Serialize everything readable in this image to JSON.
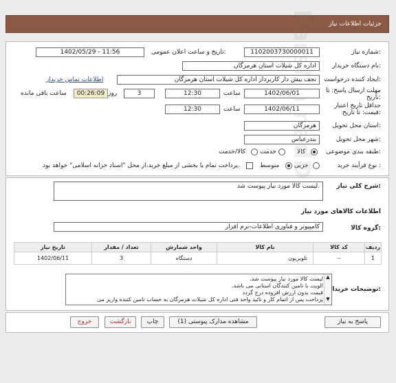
{
  "header": {
    "title": "جزئیات اطلاعات نیاز"
  },
  "form": {
    "need_number_label": "شماره نیاز:",
    "need_number": "1102003730000011",
    "announce_label": "تاریخ و ساعت اعلان عمومی:",
    "announce_value": "1402/05/29 - 11:56",
    "buyer_org_label": "نام دستگاه خریدار:",
    "buyer_org": "اداره کل شیلات استان هرمزگان",
    "creator_label": "ایجاد کننده درخواست:",
    "creator": "نجف بیش دار کاربرداز اداره کل شیلات استان هرمزگان",
    "contact_link": "اطلاعات تماس خریدار",
    "deadline_label": "مهلت ارسال پاسخ: تا تاریخ:",
    "deadline_date": "1402/06/01",
    "time_label": "ساعت",
    "deadline_time": "12:30",
    "days_value": "3",
    "days_label": "روز و",
    "remaining_time": "00:26:09",
    "remaining_label": "ساعت باقی مانده",
    "validity_label": "حداقل تاریخ اعتبار قیمت: تا تاریخ:",
    "validity_date": "1402/06/11",
    "validity_time": "12:30",
    "province_label": "استان محل تحویل:",
    "province": "هرمزگان",
    "city_label": "شهر محل تحویل:",
    "city": "بندرعباس",
    "category_label": "طبقه بندی موضوعی:",
    "category_options": [
      "کالا",
      "خدمت",
      "کالا/خدمت"
    ],
    "process_label": "نوع فرآیند خرید :",
    "process_options": [
      "جزیی",
      "متوسط"
    ],
    "payment_note": "پرداخت تمام یا بخشی از مبلغ خرید،از محل \"اسناد خزانه اسلامی\" خواهد بود."
  },
  "needs": {
    "summary_label": "شرح کلی نیاز:",
    "summary": "لیست کالا مورد نیاز پیوست شد.",
    "goods_info_title": "اطلاعات کالاهای مورد نیاز",
    "group_label": "گروه کالا:",
    "group": "کامپیوتر و فناوری اطلاعات-نرم افزار"
  },
  "table": {
    "headers": [
      "ردیف",
      "کد کالا",
      "نام کالا",
      "واحد شمارش",
      "تعداد / مقدار",
      "تاریخ نیاز"
    ],
    "rows": [
      {
        "row": "1",
        "code": "--",
        "name": "تلویزیون",
        "unit": "دستگاه",
        "qty": "3",
        "date": "1402/06/11"
      }
    ]
  },
  "notes": {
    "label": "توضیحات خریدار:",
    "lines": [
      "لیست کالا مورد نیاز پیوست شد.",
      "الویت با تامین کنندگان استانی می باشد.",
      "قیمت بدون ارزش افزوده درج گردد",
      "پرداخت پس از اتمام کار و تائید واحد فنی اداره کل شیلات هرمزگان به حساب تامین کننده واریز می"
    ]
  },
  "buttons": {
    "reply": "پاسخ به نیاز",
    "attachments": "مشاهده مدارک پیوستی (1)",
    "print": "چاپ",
    "back": "بازگشت",
    "exit": "خروج"
  },
  "watermark": {
    "brand": "ParsNamadData",
    "brand_fa": "پارس نماد داده",
    "portal": "پایگاه اطلاع رسانی مناقصات و مزایدات",
    "phone": "۰۲۱-۸۸۳۴۹۶۷۰-۵"
  },
  "colors": {
    "header": "#8a5a44",
    "link": "#2a4fa0",
    "timer_bg": "#f2ecc7",
    "exit_text": "#c0282d"
  }
}
